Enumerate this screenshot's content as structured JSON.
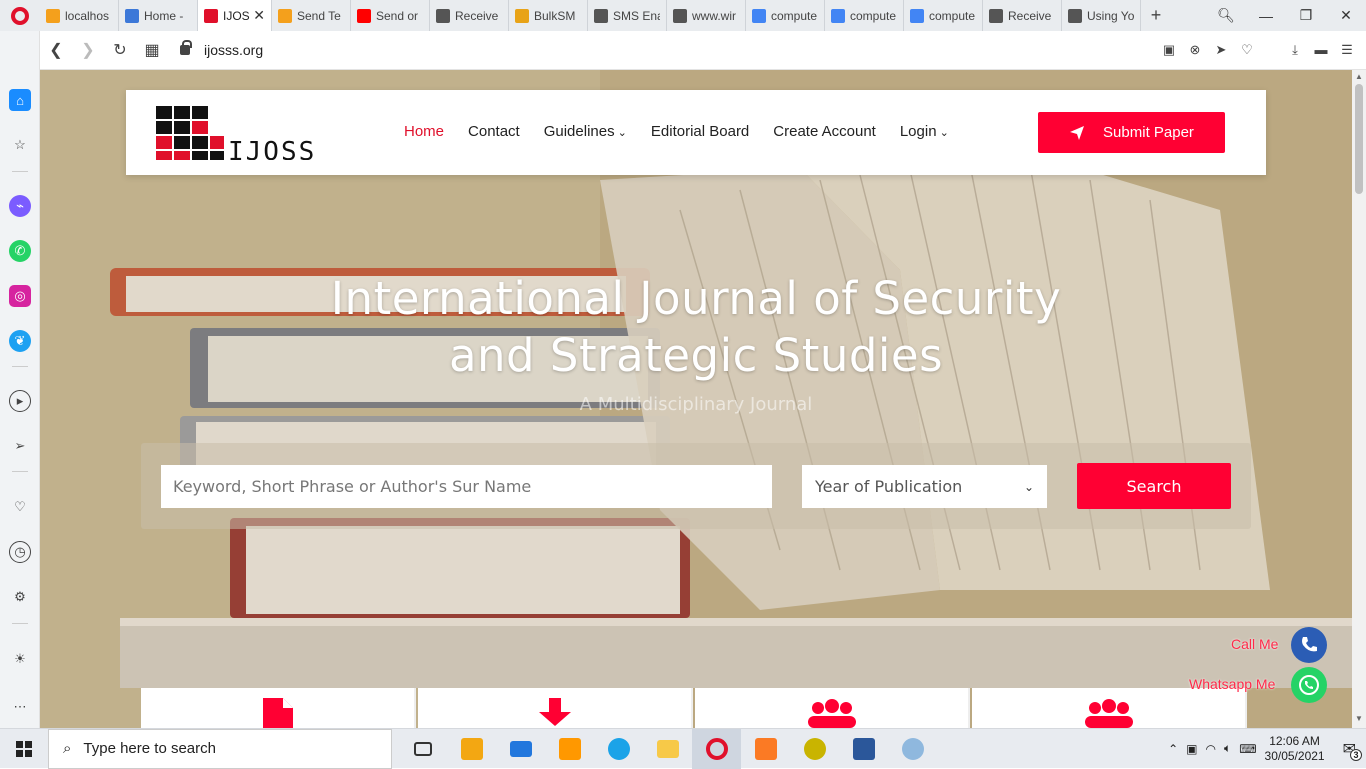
{
  "browser": {
    "tabs": [
      {
        "label": "localhos",
        "color": "#f4a01c"
      },
      {
        "label": "Home -",
        "color": "#3c78d8"
      },
      {
        "label": "IJOS",
        "color": "#e0102b",
        "active": true
      },
      {
        "label": "Send Te",
        "color": "#f4a01c"
      },
      {
        "label": "Send or",
        "color": "#ff0000"
      },
      {
        "label": "Receive",
        "color": "#555555"
      },
      {
        "label": "BulkSM",
        "color": "#e8a317"
      },
      {
        "label": "SMS Ena",
        "color": "#555555"
      },
      {
        "label": "www.wir",
        "color": "#555555"
      },
      {
        "label": "compute",
        "color": "#4285f4"
      },
      {
        "label": "compute",
        "color": "#4285f4"
      },
      {
        "label": "compute",
        "color": "#4285f4"
      },
      {
        "label": "Receive",
        "color": "#555555"
      },
      {
        "label": "Using Yo",
        "color": "#555555"
      }
    ],
    "new_tab": "+",
    "tab_close": "✕",
    "url": "ijosss.org"
  },
  "site": {
    "nav": [
      {
        "label": "Home",
        "active": true
      },
      {
        "label": "Contact"
      },
      {
        "label": "Guidelines",
        "dropdown": true
      },
      {
        "label": "Editorial Board"
      },
      {
        "label": "Create Account"
      },
      {
        "label": "Login",
        "dropdown": true
      }
    ],
    "submit_label": "Submit Paper",
    "title_line1": "International Journal of Security",
    "title_line2": "and Strategic Studies",
    "subtitle": "A Multidisciplinary Journal",
    "search": {
      "placeholder": "Keyword, Short Phrase or Author's Sur Name",
      "year_label": "Year of Publication",
      "button": "Search"
    },
    "call_label": "Call Me",
    "whatsapp_label": "Whatsapp Me",
    "accent_color": "#ff0033"
  },
  "taskbar": {
    "search_placeholder": "Type here to search",
    "time": "12:06 AM",
    "date": "30/05/2021",
    "notifications": "3"
  }
}
